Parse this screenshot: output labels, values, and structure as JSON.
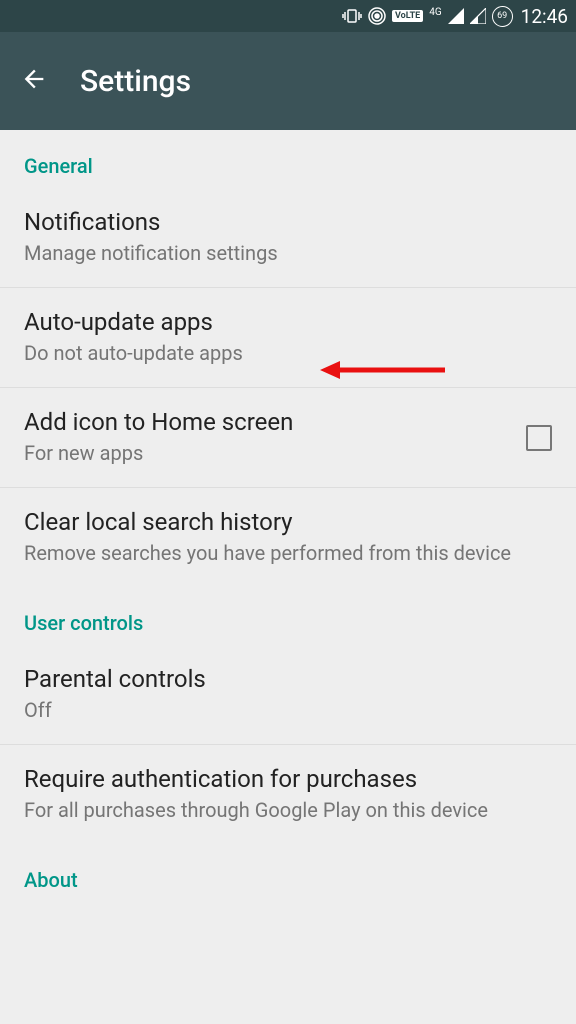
{
  "statusBar": {
    "volte": "VoLTE",
    "network": "4G",
    "battery": "69",
    "time": "12:46"
  },
  "appBar": {
    "title": "Settings"
  },
  "sections": {
    "general": {
      "header": "General",
      "notifications": {
        "title": "Notifications",
        "subtitle": "Manage notification settings"
      },
      "autoUpdate": {
        "title": "Auto-update apps",
        "subtitle": "Do not auto-update apps"
      },
      "addIcon": {
        "title": "Add icon to Home screen",
        "subtitle": "For new apps"
      },
      "clearHistory": {
        "title": "Clear local search history",
        "subtitle": "Remove searches you have performed from this device"
      }
    },
    "userControls": {
      "header": "User controls",
      "parental": {
        "title": "Parental controls",
        "subtitle": "Off"
      },
      "auth": {
        "title": "Require authentication for purchases",
        "subtitle": "For all purchases through Google Play on this device"
      }
    },
    "about": {
      "header": "About"
    }
  }
}
